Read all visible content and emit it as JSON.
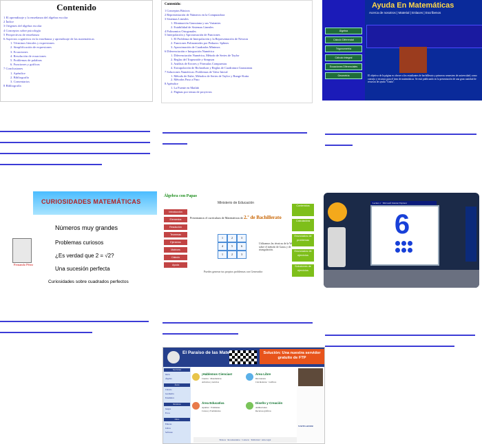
{
  "thumb1": {
    "title": "Contenido",
    "items": [
      {
        "text": "1   El aprendizaje y la enseñanza del álgebra escolar",
        "sub": false
      },
      {
        "text": "2   Índice",
        "sub": false
      },
      {
        "text": "3   Orígenes del álgebra escolar",
        "sub": false
      },
      {
        "text": "4   Conceptos sobre psicología",
        "sub": false
      },
      {
        "text": "5   Perspectivas de enseñanza",
        "sub": false
      },
      {
        "text": "6   Aspectos cognitivos en la enseñanza y aprendizaje de las matemáticas",
        "sub": false
      },
      {
        "text": "1.  Términos literales y expresiones",
        "sub": true
      },
      {
        "text": "2.  Simplificación de expresiones",
        "sub": true
      },
      {
        "text": "3.  Ecuaciones",
        "sub": true
      },
      {
        "text": "4.  Resolución de ecuaciones",
        "sub": true
      },
      {
        "text": "5.  Problemas de palabras",
        "sub": true
      },
      {
        "text": "6.  Funciones y gráficas",
        "sub": true
      },
      {
        "text": "7   Conclusiones",
        "sub": false
      },
      {
        "text": "1.  Apéndice",
        "sub": true
      },
      {
        "text": "2.  Bibliografía",
        "sub": true
      },
      {
        "text": "3.  Comentarios",
        "sub": true
      },
      {
        "text": "8   Bibliografía",
        "sub": false
      }
    ]
  },
  "thumb2": {
    "header": "Contenido:",
    "items": [
      {
        "text": "1   Conceptos Básicos",
        "sub": false
      },
      {
        "text": "2   Representación de Números en la Computadora",
        "sub": false
      },
      {
        "text": "3   Sistemas Lineales",
        "sub": false
      },
      {
        "text": "1.   Eliminación Gaussiana y sus Variantes",
        "sub": true
      },
      {
        "text": "2.   Estabilidad de Sistemas Lineales",
        "sub": true
      },
      {
        "text": "4   Polinomios Ortogonales",
        "sub": false
      },
      {
        "text": "5   Interpolación y Aproximación de Funciones",
        "sub": false
      },
      {
        "text": "1.   El Problema de Interpolación y la Representación de Newton",
        "sub": true
      },
      {
        "text": "2.   Funciones Polinomiales por Pedazos: Splines",
        "sub": true
      },
      {
        "text": "3.   Aproximación de Cuadrados Mínimos",
        "sub": true
      },
      {
        "text": "6   Diferenciación e Integración Numérica",
        "sub": false
      },
      {
        "text": "1.   Diferenciación Numérica, Método de Series de Taylor",
        "sub": true
      },
      {
        "text": "2.   Reglas del Trapezoide y Simpson",
        "sub": true
      },
      {
        "text": "3.   Análisis de Errores y Fórmulas Compuestas",
        "sub": true
      },
      {
        "text": "4.   Extrapolación de Richardson y Reglas de Cuadratura Gaussianas",
        "sub": true
      },
      {
        "text": "7   Soluciones Numéricas: Problemas de Valor Inicial",
        "sub": false
      },
      {
        "text": "1.   Método de Euler, Métodos de Series de Taylor y Runge-Kutta",
        "sub": true
      },
      {
        "text": "2.   Métodos Paso a Paso",
        "sub": true
      },
      {
        "text": "8   Apéndice",
        "sub": false
      },
      {
        "text": "1.   La Fuente en Matlab",
        "sub": true
      },
      {
        "text": "2.   Páginas por temas de proyectos",
        "sub": true
      }
    ]
  },
  "thumb3": {
    "title": "Ayuda En Matemáticas",
    "menu": "Acerca de nosotros  |  Material  |  Enlaces  |  Escríbenos",
    "nav": [
      "Álgebra",
      "Cálculo Diferencial",
      "Trigonometría",
      "Cálculo Integral",
      "Ecuaciones Diferenciales",
      "Geometría"
    ],
    "paragraph": "El objetivo de la página es ofrecer a los estudiantes de bachillerato y primeros semestres de universidad, como consejo y recursos para el área de matemáticas. Se está publicando en la presentación de una gran cantidad de recursos de ayuda \"Gratis\"."
  },
  "thumb4": {
    "title": "CURIOSIDADES MATEMÁTICAS",
    "items": [
      "Números muy grandes",
      "Problemas curiosos",
      "¿Es verdad que 2 = √2?",
      "Una sucesión perfecta",
      "Curiosidades sobre cuadrados perfectos"
    ],
    "figure_label": "Fernando Pérez"
  },
  "thumb5": {
    "logo": "Álgebra con Papas",
    "ministry": "Ministerio de Educación",
    "intro": "Presentamos el currículum de Matemáticas de",
    "grade": "2.º de Bachillerato",
    "buttons": [
      "Contenidos",
      "Calculadora",
      "Enunciados de problemas",
      "Enunciados de ejercicios",
      "Soluciones de ejercicios"
    ],
    "side": [
      "Introducción",
      "Elementos",
      "Resolución",
      "Teoremas",
      "Ejercicios",
      "Matrices",
      "Cálculo",
      "Ayuda"
    ],
    "bluetext": "Utilizamos las técnicas de la Web sobre el método de Gauss y de triangulación.",
    "footer": "Puedes generar tus propios problemas con Generador"
  },
  "thumb6": {
    "bar": "Lectura 1 · Microsoft Internet Explorer",
    "digit": "6"
  },
  "thumb7": {
    "title": "El Paraíso de las Matemáticas",
    "promo": "Solución: Una nuestra servidor gratuito de FTP",
    "nav_headers": [
      "Secciones",
      "Áreas",
      "Recursos",
      "Otros"
    ],
    "nav_items": [
      "Inicio",
      "Álgebra",
      "Cálculo",
      "Geometría",
      "Estadística",
      "Juegos",
      "Foros",
      "Enlaces",
      "Libros",
      "Software"
    ],
    "sections": [
      {
        "head": "¡Hablemos Ciencias!",
        "lines": [
          "Ciencia · Matemáticas",
          "Artículos y noticias"
        ]
      },
      {
        "head": "Área Libre",
        "lines": [
          "Diccionario",
          "Calculadoras · Gráficos"
        ]
      },
      {
        "head": "Área Educativa",
        "lines": [
          "Apuntes · Exámenes",
          "Cursos y Formularios"
        ]
      },
      {
        "head": "Diseño y Creación",
        "lines": [
          "Animaciones",
          "Recursos gráficos"
        ]
      }
    ],
    "bottom": "Enlaces · Recomendados · Contacto · Publicidad · Aviso legal",
    "right_label": "NAVEGADOR"
  }
}
